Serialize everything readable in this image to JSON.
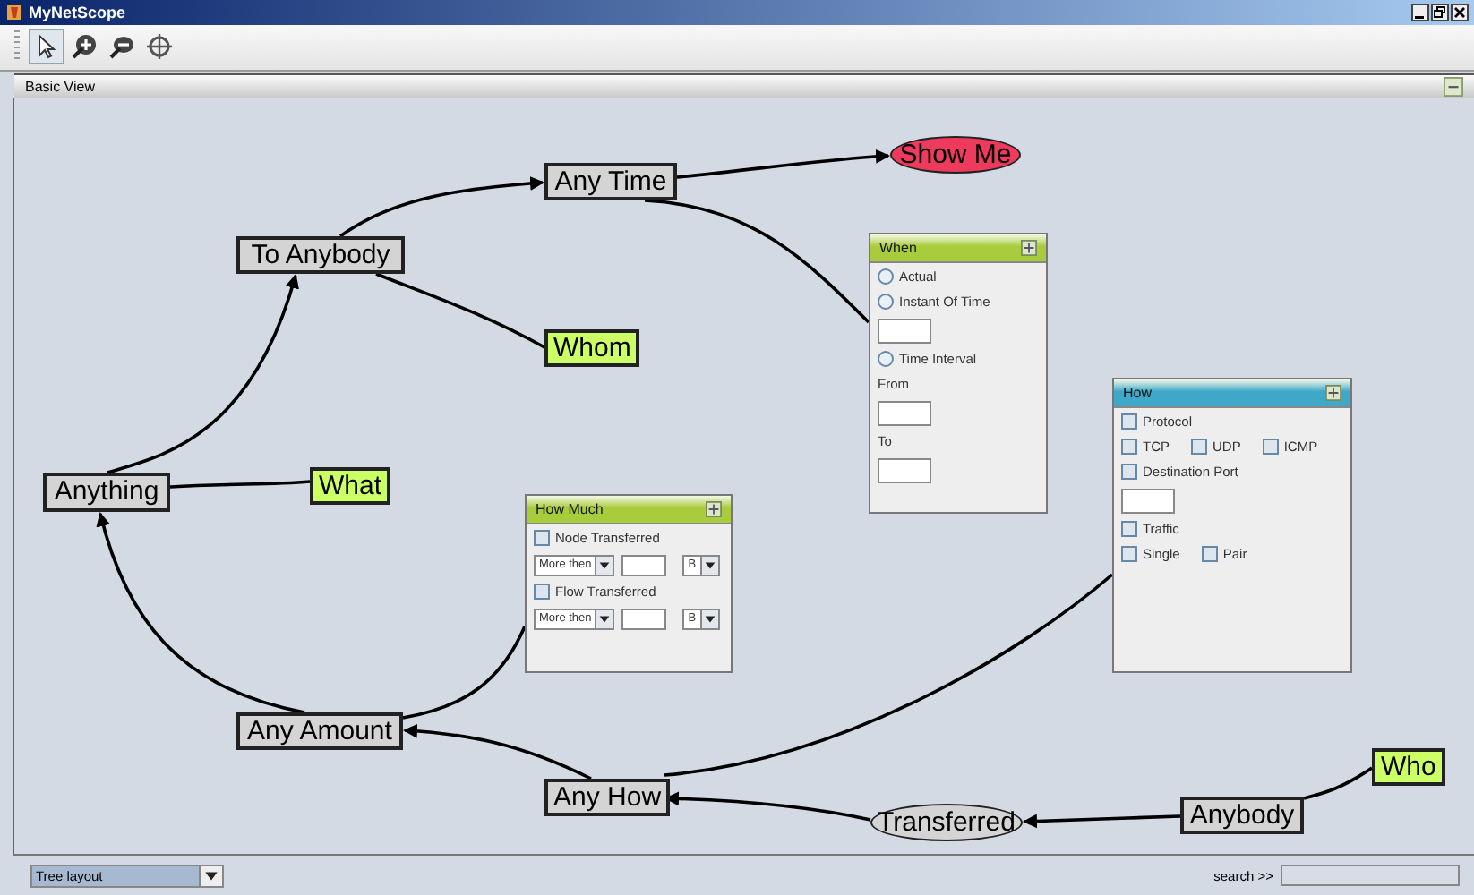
{
  "window": {
    "title": "MyNetScope"
  },
  "toolbar": {
    "tools": [
      {
        "selected": true
      },
      {
        "selected": false
      },
      {
        "selected": false
      },
      {
        "selected": false
      }
    ]
  },
  "view": {
    "title": "Basic View"
  },
  "nodes": [
    {
      "label": "Anything",
      "kind": "box",
      "color": "#d4d4d4"
    },
    {
      "label": "To Anybody",
      "kind": "box",
      "color": "#d4d4d4"
    },
    {
      "label": "Any Time",
      "kind": "box",
      "color": "#d4d4d4"
    },
    {
      "label": "Show Me",
      "kind": "oval",
      "color": "#ee3a5c"
    },
    {
      "label": "Whom",
      "kind": "box",
      "color": "#ccff66"
    },
    {
      "label": "What",
      "kind": "box",
      "color": "#ccff66"
    },
    {
      "label": "Any Amount",
      "kind": "box",
      "color": "#d4d4d4"
    },
    {
      "label": "Any How",
      "kind": "box",
      "color": "#d4d4d4"
    },
    {
      "label": "Transferred",
      "kind": "oval",
      "color": "#d4d4d4"
    },
    {
      "label": "Anybody",
      "kind": "box",
      "color": "#d4d4d4"
    },
    {
      "label": "Who",
      "kind": "box",
      "color": "#ccff66"
    }
  ],
  "panels": [
    {
      "title": "When",
      "color": "#a8cc3c",
      "rows": [
        {
          "kind": "radio",
          "label": "Actual",
          "checked": false
        },
        {
          "kind": "radio",
          "label": "Instant Of Time",
          "checked": false
        },
        {
          "kind": "field"
        },
        {
          "kind": "radio",
          "label": "Time Interval",
          "checked": false
        },
        {
          "kind": "label",
          "label": "From"
        },
        {
          "kind": "field"
        },
        {
          "kind": "label",
          "label": "To"
        },
        {
          "kind": "field"
        }
      ]
    },
    {
      "title": "How Much",
      "color": "#a8cc3c",
      "rows": [
        {
          "kind": "checks",
          "items": [
            {
              "label": "Node Transferred",
              "checked": false
            }
          ]
        },
        {
          "kind": "filter",
          "operator": "More then",
          "unit": "B"
        },
        {
          "kind": "checks",
          "items": [
            {
              "label": "Flow Transferred",
              "checked": false
            }
          ]
        },
        {
          "kind": "filter",
          "operator": "More then",
          "unit": "B"
        }
      ]
    },
    {
      "title": "How",
      "color": "#3fa8c8",
      "rows": [
        {
          "kind": "checks",
          "items": [
            {
              "label": "Protocol",
              "checked": false
            }
          ]
        },
        {
          "kind": "checks",
          "items": [
            {
              "label": "TCP",
              "checked": false
            },
            {
              "label": "UDP",
              "checked": false
            },
            {
              "label": "ICMP",
              "checked": false
            }
          ]
        },
        {
          "kind": "checks",
          "items": [
            {
              "label": "Destination Port",
              "checked": false
            }
          ]
        },
        {
          "kind": "field"
        },
        {
          "kind": "checks",
          "items": [
            {
              "label": "Traffic",
              "checked": false
            }
          ]
        },
        {
          "kind": "checks",
          "items": [
            {
              "label": "Single",
              "checked": false
            },
            {
              "label": "Pair",
              "checked": false
            }
          ]
        }
      ]
    }
  ],
  "bottom": {
    "layout": "Tree layout",
    "search_label": "search >>"
  }
}
